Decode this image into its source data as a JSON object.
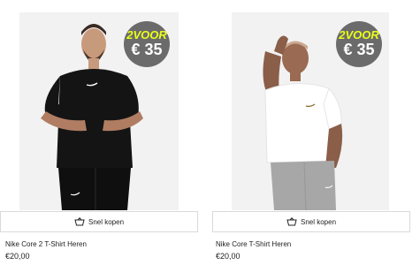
{
  "products": [
    {
      "badge_top": "2VOOR",
      "badge_price": "€ 35",
      "quickbuy_label": "Snel kopen",
      "title": "Nike Core 2 T-Shirt Heren",
      "price": "€20,00"
    },
    {
      "badge_top": "2VOOR",
      "badge_price": "€ 35",
      "quickbuy_label": "Snel kopen",
      "title": "Nike Core T-Shirt Heren",
      "price": "€20,00"
    }
  ],
  "icons": {
    "quickbuy": "shopping-basket-icon"
  },
  "colors": {
    "badge_bg": "#6b6b6b",
    "badge_accent": "#e9ff1a"
  }
}
